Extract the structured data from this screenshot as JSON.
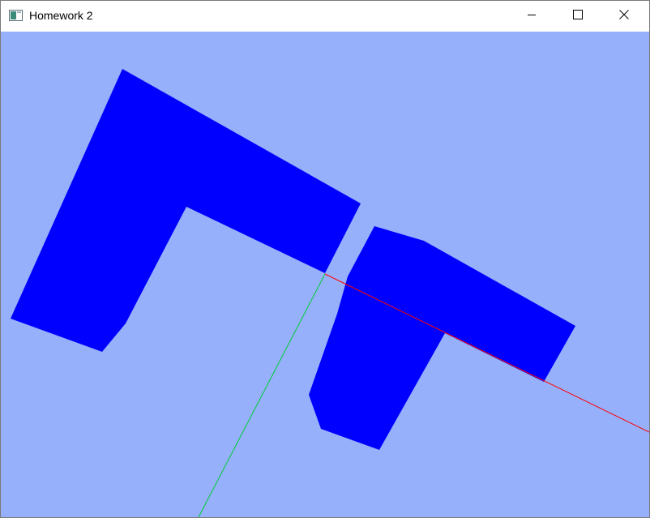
{
  "window": {
    "title": "Homework 2",
    "icon": "application-window-icon",
    "controls": {
      "minimize_icon": "minimize-icon",
      "maximize_icon": "maximize-icon",
      "close_icon": "close-icon"
    }
  },
  "scene": {
    "background_color": "#96B0FC",
    "shape_color": "#0000FF",
    "x_axis_color": "#FF0000",
    "y_axis_color": "#00CC33",
    "shapes": [
      {
        "name": "original-l-shape"
      },
      {
        "name": "transformed-l-shape"
      }
    ]
  }
}
